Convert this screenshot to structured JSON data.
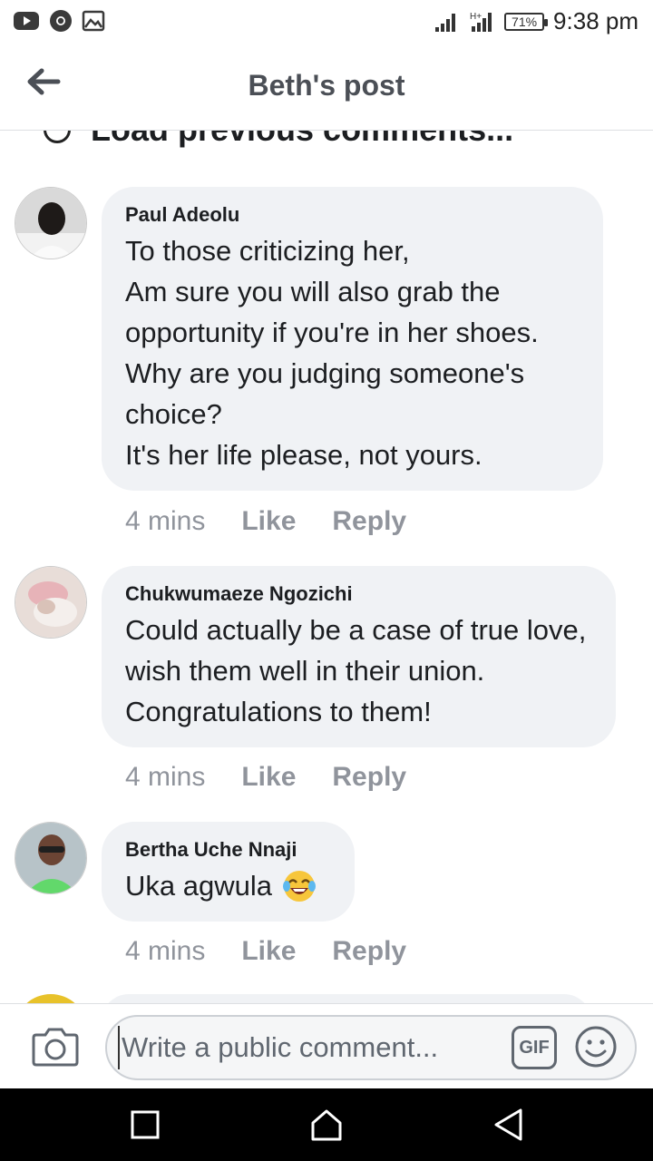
{
  "status_bar": {
    "time": "9:38 pm",
    "battery": "71%",
    "left_icons": [
      "youtube-icon",
      "chrome-icon",
      "gallery-icon"
    ],
    "right_icons": [
      "signal-icon",
      "signal-h-icon",
      "battery-icon"
    ]
  },
  "header": {
    "title": "Beth's post",
    "back_icon": "back-arrow-icon"
  },
  "load_previous": "Load previous comments...",
  "comments": [
    {
      "author": "Paul Adeolu",
      "text": "To those criticizing her,\nAm sure you will also grab the opportunity if you're in her shoes.\nWhy are you judging someone's choice?\nIt's her life please, not yours.",
      "time": "4 mins",
      "like": "Like",
      "reply": "Reply"
    },
    {
      "author": "Chukwumaeze Ngozichi",
      "text": "Could actually be a case of true love, wish them well in their union.\nCongratulations to them!",
      "time": "4 mins",
      "like": "Like",
      "reply": "Reply"
    },
    {
      "author": "Bertha Uche Nnaji",
      "text": "Uka agwula",
      "emoji": "laughing-emoji-icon",
      "time": "4 mins",
      "like": "Like",
      "reply": "Reply"
    }
  ],
  "composer": {
    "placeholder": "Write a public comment...",
    "gif_label": "GIF",
    "camera_icon": "camera-icon",
    "emoji_icon": "smiley-icon"
  },
  "nav": {
    "icons": [
      "recents-square-icon",
      "home-icon",
      "back-triangle-icon"
    ]
  },
  "colors": {
    "bubble": "#f0f2f5",
    "meta_gray": "#90949c",
    "header_title": "#4b4f56",
    "nav_bar": "#000000"
  }
}
